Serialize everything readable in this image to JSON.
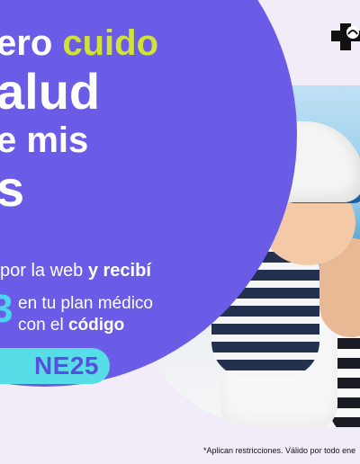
{
  "headline": {
    "line1_prefix": "ero",
    "line1_highlight": "cuido",
    "line2": "alud",
    "line3": "e mis",
    "line4": "s"
  },
  "promo": {
    "line1_regular": "por la web",
    "line1_bold": "y recibí",
    "discount_fragment": "3",
    "line2": "en tu plan médico",
    "line3_regular": "con el",
    "line3_bold": "código",
    "code": "NE25"
  },
  "footnote": "*Aplican restricciones. Válido por todo ene",
  "colors": {
    "panel": "#6b5ce7",
    "highlight": "#cfe235",
    "accent": "#56dde8",
    "background": "#f1ecf8"
  },
  "icons": {
    "logo": "medical-cross-logo-icon"
  }
}
